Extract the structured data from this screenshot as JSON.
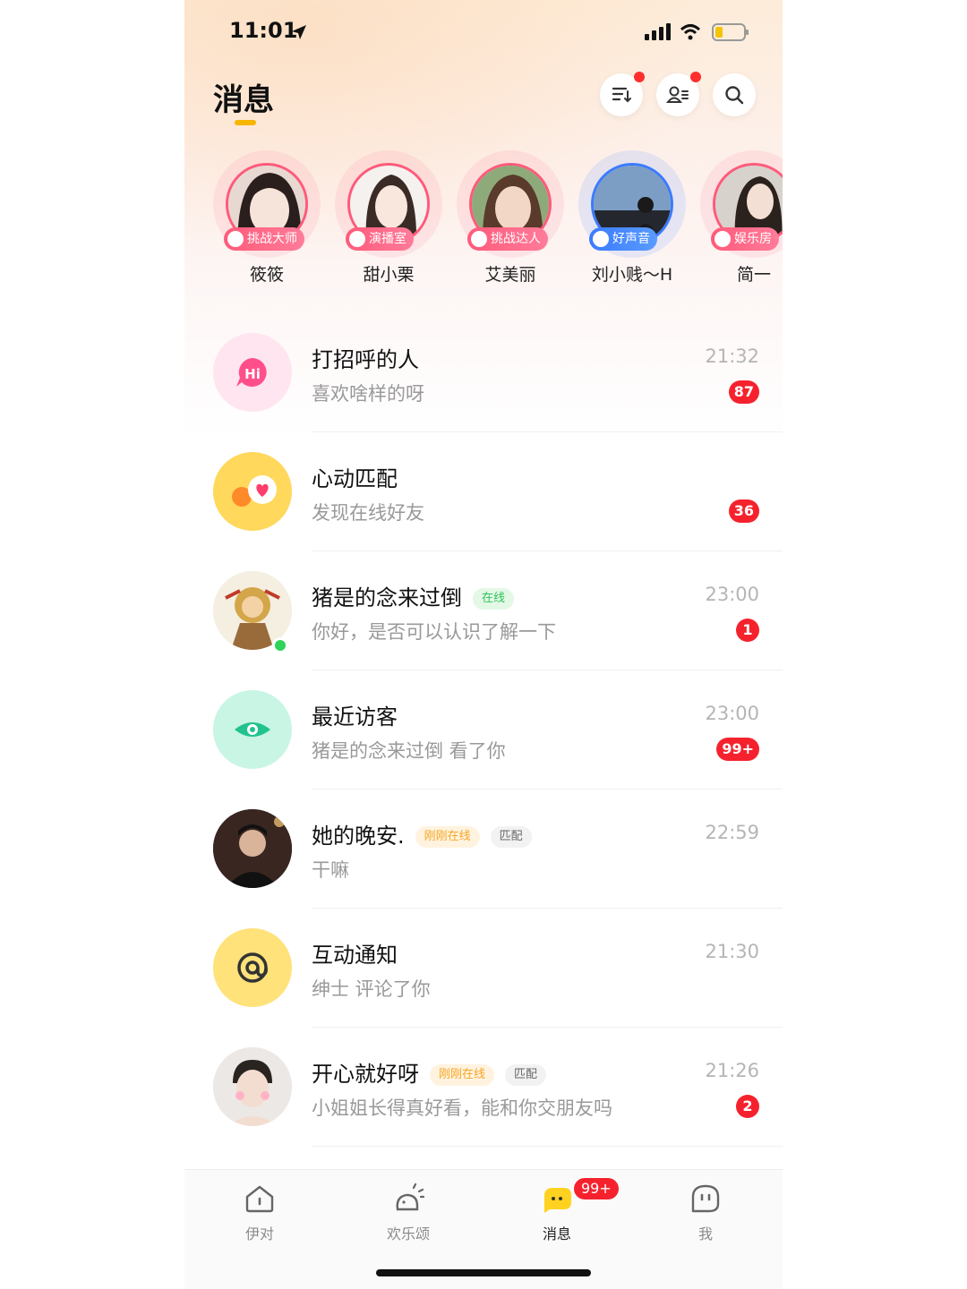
{
  "status_bar": {
    "time": "11:01"
  },
  "header": {
    "title": "消息"
  },
  "stories": [
    {
      "name": "筱筱",
      "tag": "挑战大师",
      "tag_style": "pink"
    },
    {
      "name": "甜小栗",
      "tag": "演播室",
      "tag_style": "pink"
    },
    {
      "name": "艾美丽",
      "tag": "挑战达人",
      "tag_style": "pink"
    },
    {
      "name": "刘小贱～H",
      "tag": "好声音",
      "tag_style": "blue"
    },
    {
      "name": "简一",
      "tag": "娱乐房",
      "tag_style": "pink"
    }
  ],
  "messages": [
    {
      "name": "打招呼的人",
      "preview": "喜欢啥样的呀",
      "time": "21:32",
      "badge": "87",
      "icon": "hi-bubble-icon"
    },
    {
      "name": "心动匹配",
      "preview": "发现在线好友",
      "time": "",
      "badge": "36",
      "icon": "heart-chat-icon"
    },
    {
      "name": "猪是的念来过倒",
      "preview": "你好，是否可以认识了解一下",
      "time": "23:00",
      "badge": "1",
      "pill": "在线"
    },
    {
      "name": "最近访客",
      "preview": "猪是的念来过倒 看了你",
      "time": "23:00",
      "badge": "99+",
      "icon": "eye-icon"
    },
    {
      "name": "她的晚安.",
      "preview": "干嘛",
      "time": "22:59",
      "badge": "",
      "pill": "刚刚在线",
      "pill2": "匹配"
    },
    {
      "name": "互动通知",
      "preview": "绅士 评论了你",
      "time": "21:30",
      "badge": "",
      "icon": "at-icon"
    },
    {
      "name": "开心就好呀",
      "preview": "小姐姐长得真好看，能和你交朋友吗",
      "time": "21:26",
      "badge": "2",
      "pill": "刚刚在线",
      "pill2": "匹配"
    }
  ],
  "tabs": [
    {
      "label": "伊对",
      "icon": "home-icon"
    },
    {
      "label": "欢乐颂",
      "icon": "sun-icon"
    },
    {
      "label": "消息",
      "icon": "chat-icon",
      "badge": "99+"
    },
    {
      "label": "我",
      "icon": "face-icon"
    }
  ],
  "colors": {
    "accent": "#f7b500",
    "badge": "#f5222d",
    "online": "#2fd35a"
  }
}
